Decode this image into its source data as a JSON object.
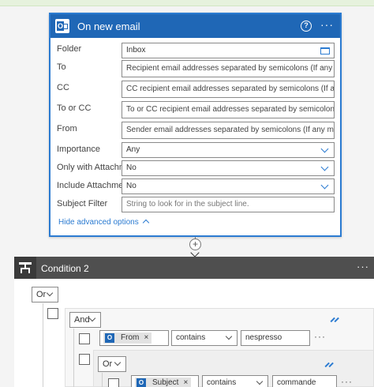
{
  "trigger": {
    "title": "On new email",
    "fields": [
      {
        "label": "Folder",
        "value": "Inbox"
      },
      {
        "label": "To",
        "placeholder": "Recipient email addresses separated by semicolons (If any match, the"
      },
      {
        "label": "CC",
        "placeholder": "CC recipient email addresses separated by semicolons (If any match,"
      },
      {
        "label": "To or CC",
        "placeholder": "To or CC recipient email addresses separated by semicolons (If any m"
      },
      {
        "label": "From",
        "placeholder": "Sender email addresses separated by semicolons (If any match, the tr"
      },
      {
        "label": "Importance",
        "value": "Any"
      },
      {
        "label": "Only with Attachments",
        "value": "No"
      },
      {
        "label": "Include Attachments",
        "value": "No"
      },
      {
        "label": "Subject Filter",
        "placeholder": "String to look for in the subject line."
      }
    ],
    "hide_advanced": "Hide advanced options"
  },
  "connector": {
    "plus": "+"
  },
  "condition": {
    "title": "Condition 2",
    "outer_operator": "Or",
    "and_operator": "And",
    "row1": {
      "token": "From",
      "operator": "contains",
      "value": "nespresso"
    },
    "inner_operator": "Or",
    "row2": {
      "token": "Subject",
      "operator": "contains",
      "value": "commande"
    }
  },
  "colors": {
    "accent": "#2b7bd1",
    "header": "#1f67b6",
    "condition_header": "#4f4f4f"
  }
}
